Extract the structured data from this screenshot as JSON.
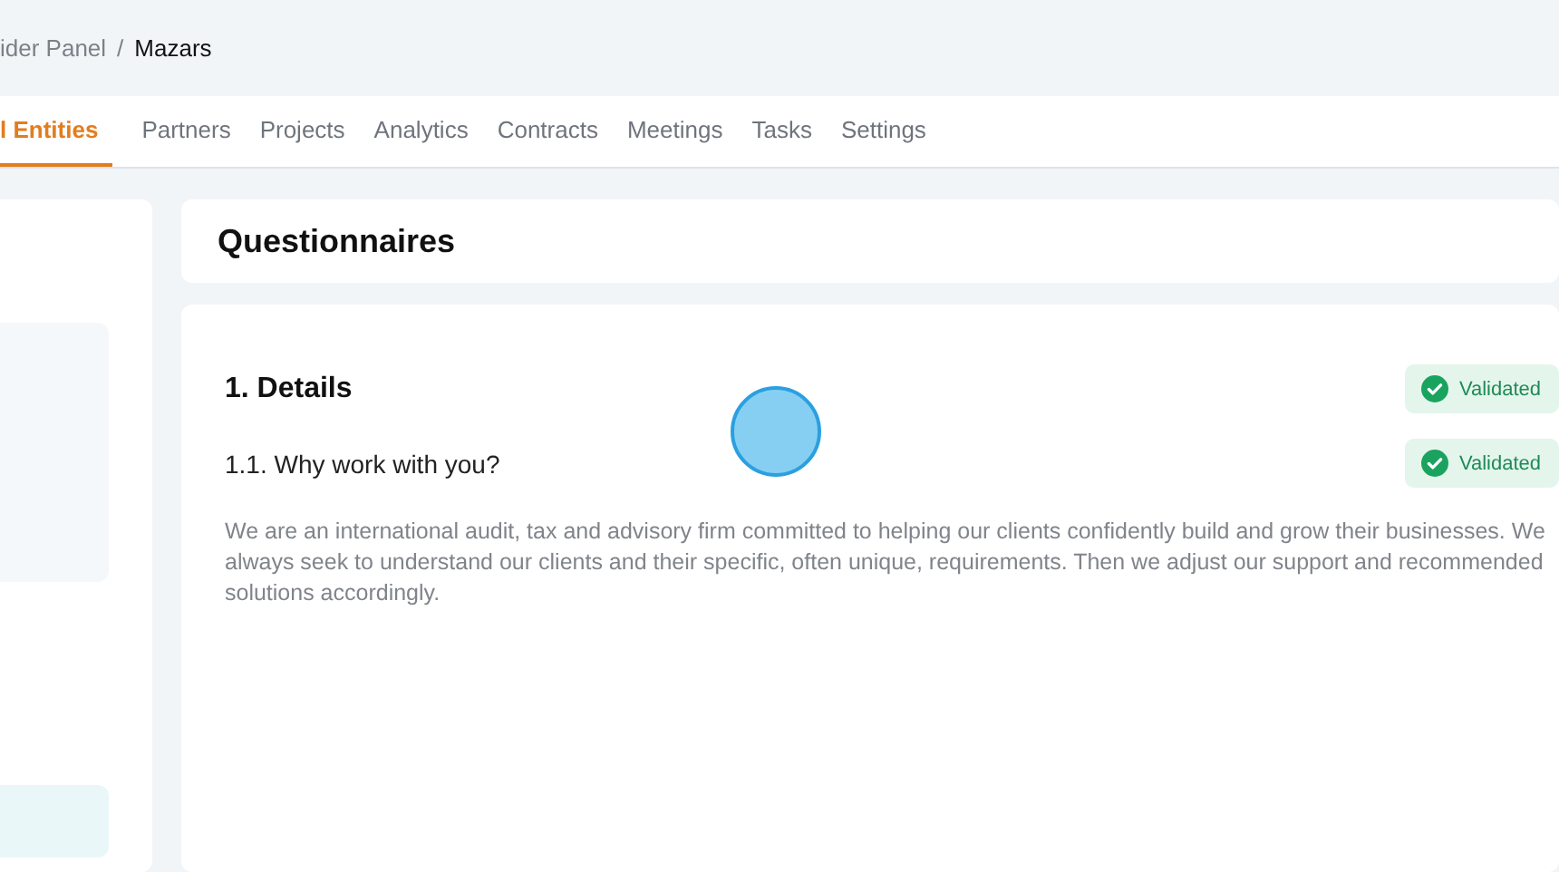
{
  "breadcrumb_separator": "/",
  "breadcrumb": [
    {
      "label": "ider Panel",
      "current": false
    },
    {
      "label": "Mazars",
      "current": true
    }
  ],
  "tabs": [
    {
      "label": "l Entities",
      "selected": true
    },
    {
      "label": "Partners",
      "selected": false
    },
    {
      "label": "Projects",
      "selected": false
    },
    {
      "label": "Analytics",
      "selected": false
    },
    {
      "label": "Contracts",
      "selected": false
    },
    {
      "label": "Meetings",
      "selected": false
    },
    {
      "label": "Tasks",
      "selected": false
    },
    {
      "label": "Settings",
      "selected": false
    }
  ],
  "page_title": "Questionnaires",
  "sections": [
    {
      "title": "1. Details",
      "status": "Validated",
      "questions": [
        {
          "title": "1.1. Why work with you?",
          "status": "Validated",
          "answer": "We are an international audit, tax and advisory firm committed to helping our clients confidently build and grow their businesses. We always seek to understand our clients and their specific, often unique, requirements. Then we adjust our support and recommended solutions accordingly."
        }
      ]
    }
  ]
}
